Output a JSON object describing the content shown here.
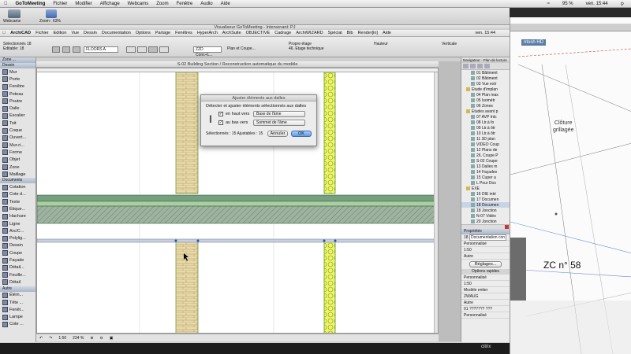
{
  "mac_menubar": {
    "apple": "",
    "app": "GoToMeeting",
    "items": [
      "Fichier",
      "Modifier",
      "Affichage",
      "Webcams",
      "Zoom",
      "Fenêtre",
      "Audio",
      "Aide"
    ],
    "status": {
      "battery": "95 %",
      "clock": "ven. 15:44"
    }
  },
  "gtm_toolbar": {
    "webcams_label": "Webcams",
    "zoom_label": "Zoom : 63%"
  },
  "viewer": {
    "title": "Visualiseur GoToMeeting - Intervenant: PJ"
  },
  "archicad_menu": {
    "items": [
      "ArchiCAD",
      "Fichier",
      "Edition",
      "Vue",
      "Dessin",
      "Documentation",
      "Options",
      "Partage",
      "Fenêtres",
      "HyperArch",
      "ArchSuite",
      "OBJECTIVE",
      "Cadrage",
      "ArchiWIZARD",
      "Spécial",
      "Bib",
      "Render[in]",
      "Aide"
    ],
    "clock": "ven. 15:44"
  },
  "info_box": {
    "selection": "Sélectionnés 18",
    "editable": "Editable: 18",
    "floor": "FLOORS A",
    "plan_label": "Plan et Coupe...",
    "structure": "ZZD Conc+L...",
    "storey": "Propre étage",
    "storey_value": "46. Etage technique",
    "hauteur": "Hauteur",
    "verticale": "Verticale"
  },
  "toolbox": {
    "sections": [
      {
        "name": "Zone ...",
        "items": []
      },
      {
        "name": "Dessin",
        "items": [
          "Mur",
          "Porte",
          "Fenêtre",
          "Poteau",
          "Poutre",
          "Dalle",
          "Escalier",
          "Toit",
          "Coque",
          "Ouvert...",
          "Mur-ri...",
          "Forme",
          "Objet",
          "Zone",
          "Maillage"
        ]
      },
      {
        "name": "Documents",
        "items": [
          "Cotation",
          "Cote d...",
          "Texte",
          "Étique...",
          "Hachure",
          "Ligne",
          "Arc/C...",
          "Polylig...",
          "Dessin",
          "Coupe",
          "Façade",
          "Détail...",
          "Feuille...",
          "Détail"
        ]
      },
      {
        "name": "Autre",
        "items": [
          "Élém...",
          "Tête ...",
          "Fenêt...",
          "Lampe",
          "Cote ..."
        ]
      }
    ]
  },
  "canvas": {
    "title": "S-02 Building Section / Reconstruction automatique du modèle",
    "footer": {
      "scale": "1:50",
      "zoom": "234 %"
    }
  },
  "dialog": {
    "title": "Ajuster éléments aux dalles",
    "heading": "Détecter et ajuster éléments sélectionnés aux dalles",
    "row1_label": "en haut vers",
    "row1_value": "Base de l'âme",
    "row2_label": "au bas vers",
    "row2_value": "Sommet de l'âme",
    "status": "Sélectionnés : 15   Ajustables : 15",
    "cancel": "Annuler",
    "ok": "OK"
  },
  "navigator": {
    "header": "Navigateur - Plan de lecture",
    "items": [
      {
        "label": "01 Bâtiment",
        "type": "item"
      },
      {
        "label": "02 Bâtiment",
        "type": "item"
      },
      {
        "label": "03 Vue extr",
        "type": "item"
      },
      {
        "label": "Etude d'implan",
        "type": "folder"
      },
      {
        "label": "04 Plan mas",
        "type": "item"
      },
      {
        "label": "05 Isométr",
        "type": "item"
      },
      {
        "label": "06 Zones",
        "type": "item"
      },
      {
        "label": "Etudes avant p",
        "type": "folder"
      },
      {
        "label": "07 AVP Intc",
        "type": "item"
      },
      {
        "label": "08 Ltr.à fo",
        "type": "item"
      },
      {
        "label": "09 Ltr.à ôtr",
        "type": "item"
      },
      {
        "label": "10 Ltr.à ôtr",
        "type": "item"
      },
      {
        "label": "11 3D plan",
        "type": "item"
      },
      {
        "label": "VIDEO Coup",
        "type": "item"
      },
      {
        "label": "12 Plans de",
        "type": "item"
      },
      {
        "label": "2/L Coupe P",
        "type": "item"
      },
      {
        "label": "S-02 Coupe",
        "type": "item"
      },
      {
        "label": "13 Dalles m",
        "type": "item"
      },
      {
        "label": "14 Façades",
        "type": "item"
      },
      {
        "label": "15 Cuper a",
        "type": "item"
      },
      {
        "label": "L Pour Dos",
        "type": "item"
      },
      {
        "label": "EXE",
        "type": "folder"
      },
      {
        "label": "16 DIE inté",
        "type": "item"
      },
      {
        "label": "17 Documen",
        "type": "item"
      },
      {
        "label": "18 Documen",
        "type": "item",
        "selected": true
      },
      {
        "label": "18 Jonction",
        "type": "item"
      },
      {
        "label": "N-07 Vidéo",
        "type": "item"
      },
      {
        "label": "20 Jonction",
        "type": "item"
      }
    ]
  },
  "properties": {
    "header": "Propriétés",
    "id": "18",
    "id_value": "Documentation con",
    "personal": "Personnalisé",
    "scale": "1:50",
    "other": "Autre",
    "settings_button": "Réglages...",
    "options_header": "Options rapides",
    "options": [
      "Personnalisé",
      "1:50",
      "Modèle entier",
      "ZWAUG",
      "Autre",
      "01 ??????? ???",
      "Personnalisé"
    ]
  },
  "background_window": {
    "tab": "ntosh HD",
    "label1": "Clôture",
    "label2": "grillagée",
    "label3": "ZC n° 58"
  },
  "citrix": "citrix"
}
